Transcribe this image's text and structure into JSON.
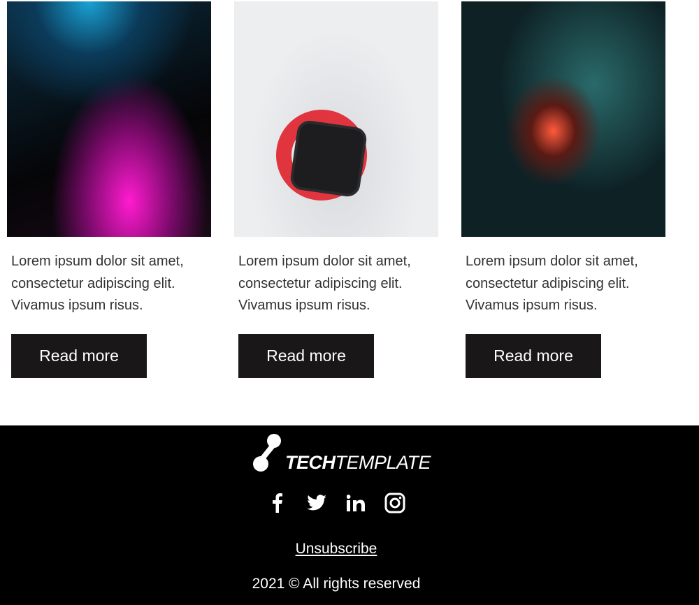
{
  "cards": [
    {
      "text": "Lorem ipsum dolor sit amet, consectetur adipiscing elit. Vivamus ipsum risus.",
      "button": "Read more",
      "image": "gaming-keyboard-image"
    },
    {
      "text": "Lorem ipsum dolor sit amet, consectetur adipiscing elit. Vivamus ipsum risus.",
      "button": "Read more",
      "image": "smartwatch-image"
    },
    {
      "text": "Lorem ipsum dolor sit amet, consectetur adipiscing elit. Vivamus ipsum risus.",
      "button": "Read more",
      "image": "game-controller-image"
    }
  ],
  "footer": {
    "logo_bold": "TECH",
    "logo_light": "TEMPLATE",
    "social": [
      "facebook-icon",
      "twitter-icon",
      "linkedin-icon",
      "instagram-icon"
    ],
    "unsubscribe": "Unsubscribe",
    "copyright": "2021 © All rights reserved"
  },
  "colors": {
    "button_bg": "#1a1718",
    "footer_bg": "#000000",
    "text": "#333333"
  }
}
